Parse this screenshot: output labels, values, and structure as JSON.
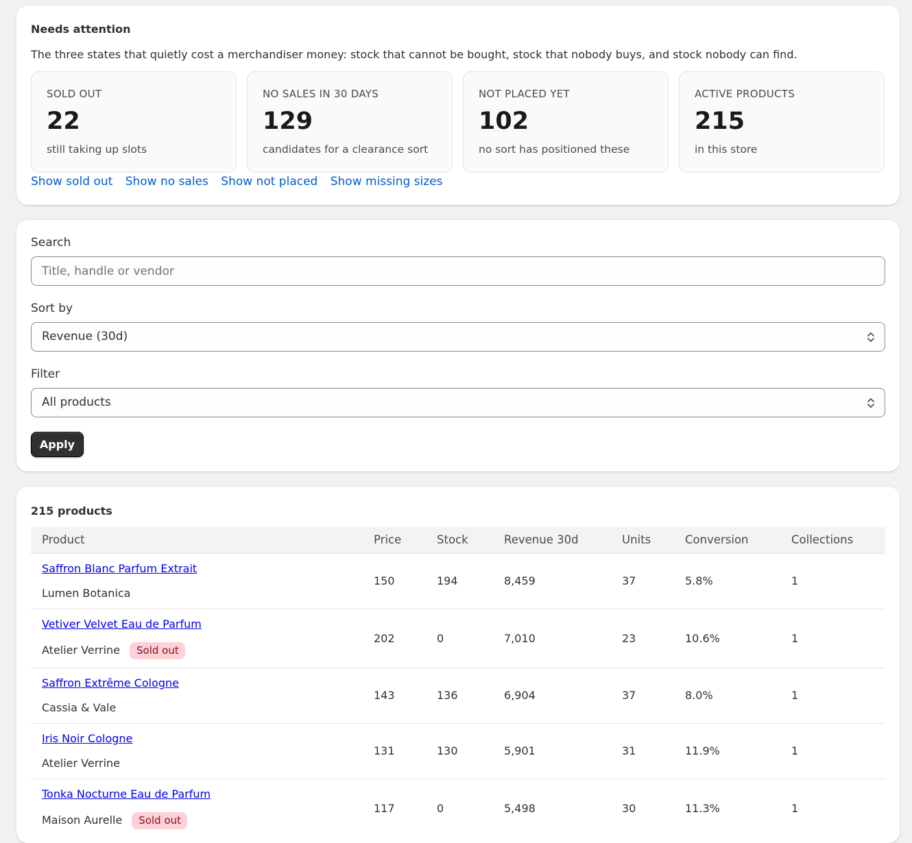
{
  "attention": {
    "title": "Needs attention",
    "description": "The three states that quietly cost a merchandiser money: stock that cannot be bought, stock that nobody buys, and stock nobody can find.",
    "stats": [
      {
        "label": "SOLD OUT",
        "value": "22",
        "sub": "still taking up slots"
      },
      {
        "label": "NO SALES IN 30 DAYS",
        "value": "129",
        "sub": "candidates for a clearance sort"
      },
      {
        "label": "NOT PLACED YET",
        "value": "102",
        "sub": "no sort has positioned these"
      },
      {
        "label": "ACTIVE PRODUCTS",
        "value": "215",
        "sub": "in this store"
      }
    ],
    "links": [
      "Show sold out",
      "Show no sales",
      "Show not placed",
      "Show missing sizes"
    ]
  },
  "form": {
    "search_label": "Search",
    "search_placeholder": "Title, handle or vendor",
    "search_value": "",
    "sort_label": "Sort by",
    "sort_value": "Revenue (30d)",
    "filter_label": "Filter",
    "filter_value": "All products",
    "apply_label": "Apply"
  },
  "table": {
    "title": "215 products",
    "columns": [
      "Product",
      "Price",
      "Stock",
      "Revenue 30d",
      "Units",
      "Conversion",
      "Collections"
    ],
    "rows": [
      {
        "title": "Saffron Blanc Parfum Extrait",
        "vendor": "Lumen Botanica",
        "badge": "",
        "price": "150",
        "stock": "194",
        "revenue": "8,459",
        "units": "37",
        "conversion": "5.8%",
        "collections": "1"
      },
      {
        "title": "Vetiver Velvet Eau de Parfum",
        "vendor": "Atelier Verrine",
        "badge": "Sold out",
        "price": "202",
        "stock": "0",
        "revenue": "7,010",
        "units": "23",
        "conversion": "10.6%",
        "collections": "1"
      },
      {
        "title": "Saffron Extrême Cologne",
        "vendor": "Cassia & Vale",
        "badge": "",
        "price": "143",
        "stock": "136",
        "revenue": "6,904",
        "units": "37",
        "conversion": "8.0%",
        "collections": "1"
      },
      {
        "title": "Iris Noir Cologne",
        "vendor": "Atelier Verrine",
        "badge": "",
        "price": "131",
        "stock": "130",
        "revenue": "5,901",
        "units": "31",
        "conversion": "11.9%",
        "collections": "1"
      },
      {
        "title": "Tonka Nocturne Eau de Parfum",
        "vendor": "Maison Aurelle",
        "badge": "Sold out",
        "price": "117",
        "stock": "0",
        "revenue": "5,498",
        "units": "30",
        "conversion": "11.3%",
        "collections": "1"
      }
    ]
  },
  "colors": {
    "link": "#005bd3",
    "product_link": "#0000ee",
    "badge_bg": "#fed1d7",
    "badge_text": "#8e0b21",
    "button_bg": "#303030"
  }
}
